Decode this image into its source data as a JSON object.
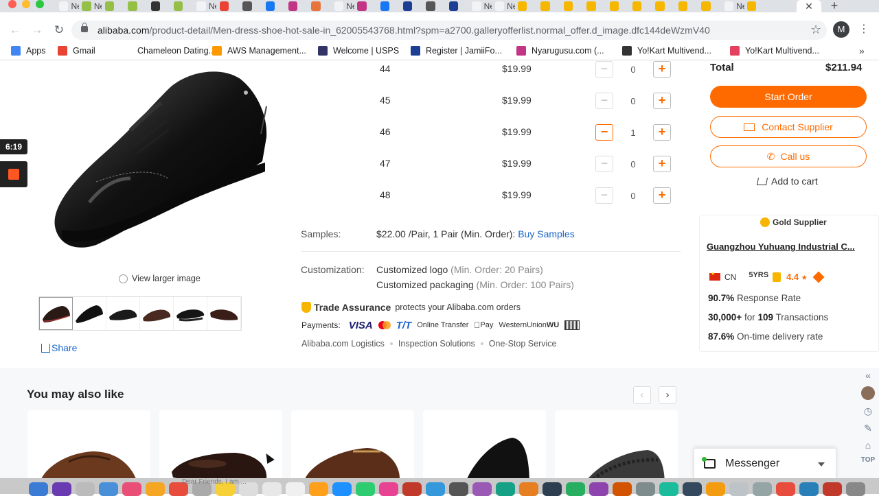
{
  "browser": {
    "tabs": [
      {
        "title": "New",
        "color": "#f1f3f4"
      },
      {
        "title": "New",
        "color": "#95bf47"
      },
      {
        "title": "",
        "color": "#95bf47"
      },
      {
        "title": "",
        "color": "#95bf47"
      },
      {
        "title": "",
        "color": "#333"
      },
      {
        "title": "",
        "color": "#95bf47"
      },
      {
        "title": "New",
        "color": "#f1f3f4"
      },
      {
        "title": "",
        "color": "#ea4335"
      },
      {
        "title": "",
        "color": "#555"
      },
      {
        "title": "",
        "color": "#1877f2"
      },
      {
        "title": "",
        "color": "#c13584"
      },
      {
        "title": "",
        "color": "#e8743b"
      },
      {
        "title": "New",
        "color": "#f1f3f4"
      },
      {
        "title": "",
        "color": "#c13584"
      },
      {
        "title": "",
        "color": "#1877f2"
      },
      {
        "title": "",
        "color": "#1c3f94"
      },
      {
        "title": "",
        "color": "#555"
      },
      {
        "title": "",
        "color": "#1c3f94"
      },
      {
        "title": "New",
        "color": "#f1f3f4"
      },
      {
        "title": "New",
        "color": "#f1f3f4"
      },
      {
        "title": "",
        "color": "#f5b700"
      },
      {
        "title": "",
        "color": "#f5b700"
      },
      {
        "title": "",
        "color": "#f5b700"
      },
      {
        "title": "",
        "color": "#f5b700"
      },
      {
        "title": "",
        "color": "#f5b700"
      },
      {
        "title": "",
        "color": "#f5b700"
      },
      {
        "title": "",
        "color": "#f5b700"
      },
      {
        "title": "",
        "color": "#f5b700"
      },
      {
        "title": "",
        "color": "#f5b700"
      },
      {
        "title": "New",
        "color": "#f1f3f4"
      },
      {
        "title": "",
        "color": "#f5b700"
      }
    ],
    "url_host": "alibaba.com",
    "url_path": "/product-detail/Men-dress-shoe-hot-sale-in_62005543768.html?spm=a2700.galleryofferlist.normal_offer.d_image.dfc144deWzmV40",
    "profile_initial": "M",
    "bookmarks": [
      {
        "label": "Apps",
        "color": "#4285f4"
      },
      {
        "label": "Gmail",
        "color": "#ea4335"
      },
      {
        "label": "Chameleon Dating...",
        "color": "#ffffff"
      },
      {
        "label": "AWS Management...",
        "color": "#ff9900"
      },
      {
        "label": "Welcome | USPS",
        "color": "#333366"
      },
      {
        "label": "Register | JamiiFo...",
        "color": "#1c3f94"
      },
      {
        "label": "Nyarugusu.com (...",
        "color": "#c13584"
      },
      {
        "label": "Yo!Kart Multivend...",
        "color": "#333"
      },
      {
        "label": "Yo!Kart Multivend...",
        "color": "#e4405f"
      }
    ],
    "bookmarks_more": "»"
  },
  "recording": {
    "time": "6:19"
  },
  "product": {
    "view_larger": "View larger image",
    "share": "Share",
    "tiers": [
      {
        "size": "44",
        "price": "$19.99",
        "qty": "0"
      },
      {
        "size": "45",
        "price": "$19.99",
        "qty": "0"
      },
      {
        "size": "46",
        "price": "$19.99",
        "qty": "1"
      },
      {
        "size": "47",
        "price": "$19.99",
        "qty": "0"
      },
      {
        "size": "48",
        "price": "$19.99",
        "qty": "0"
      }
    ],
    "minus": "−",
    "plus": "+",
    "samples_label": "Samples:",
    "samples_price": "$22.00",
    "samples_unit": " /Pair, 1 Pair",
    "samples_min": " (Min. Order): ",
    "samples_link": "Buy Samples",
    "customization_label": "Customization:",
    "custom_logo": "Customized logo",
    "custom_logo_min": " (Min. Order: 20 Pairs)",
    "custom_pack": "Customized packaging",
    "custom_pack_min": " (Min. Order: 100 Pairs)",
    "trade_assurance": "Trade Assurance",
    "trade_assurance_desc": "protects your Alibaba.com orders",
    "payments_label": "Payments:",
    "pay_visa": "VISA",
    "pay_tt": "T/T",
    "pay_online": "Online Transfer",
    "pay_apple": "Pay",
    "pay_wu": "WesternUnion",
    "pay_wu_abbr": "WU",
    "services": [
      "Alibaba.com Logistics",
      "Inspection Solutions",
      "One-Stop Service"
    ]
  },
  "order": {
    "total_label": "Total",
    "total_value": "$211.94",
    "start_order": "Start Order",
    "contact_supplier": "Contact Supplier",
    "call_us": "Call us",
    "add_to_cart": "Add to cart"
  },
  "supplier": {
    "badge": "Gold Supplier",
    "name": "Guangzhou Yuhuang Industrial C...",
    "country": "CN",
    "years": "5YRS",
    "rating": "4.4",
    "rating_star": "★",
    "response_rate": "90.7%",
    "response_label": " Response Rate",
    "transactions_amount": "30,000+",
    "transactions_for": " for ",
    "transactions_count": "109",
    "transactions_label": " Transactions",
    "ontime": "87.6%",
    "ontime_label": " On-time delivery rate"
  },
  "recommend": {
    "title": "You may also like",
    "prev": "‹",
    "next": "›"
  },
  "rail": {
    "top": "TOP"
  },
  "messenger": {
    "label": "Messenger"
  },
  "dock": {
    "note": "Dear Friends, I am ..."
  }
}
